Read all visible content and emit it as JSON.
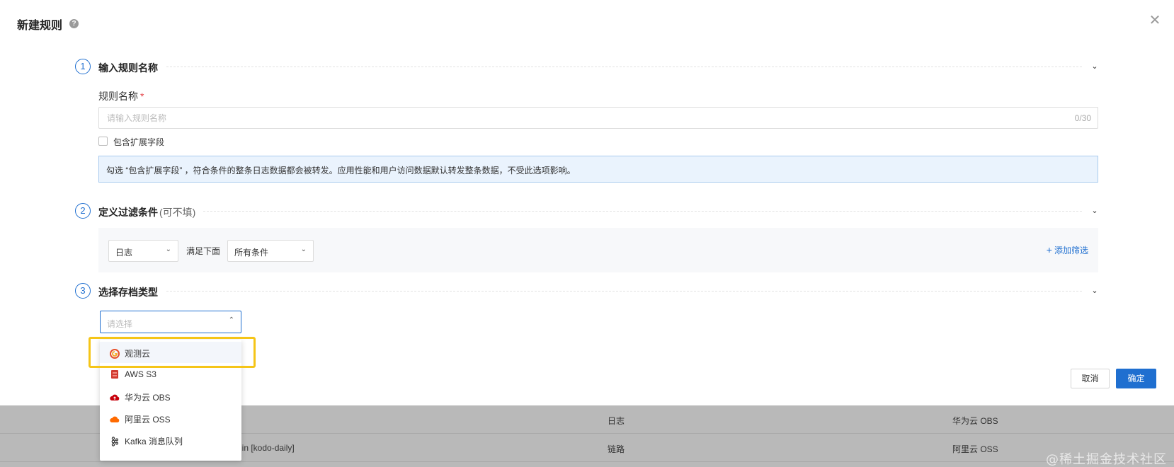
{
  "modal": {
    "title": "新建规则",
    "help_icon": "question-circle-icon",
    "close_icon": "close-icon"
  },
  "step1": {
    "num": "1",
    "title": "输入规则名称",
    "name_label": "规则名称",
    "required_mark": "*",
    "input_placeholder": "请输入规则名称",
    "input_value": "",
    "counter": "0/30",
    "checkbox_label": "包含扩展字段",
    "checkbox_checked": false,
    "info_text": "勾选 “包含扩展字段” ，符合条件的整条日志数据都会被转发。应用性能和用户访问数据默认转发整条数据，不受此选项影响。"
  },
  "step2": {
    "num": "2",
    "title": "定义过滤条件",
    "title_hint": "(可不填)",
    "source_select": "日志",
    "match_text": "满足下面",
    "condition_select": "所有条件",
    "add_filter": "添加筛选"
  },
  "step3": {
    "num": "3",
    "title": "选择存档类型",
    "select_placeholder": "请选择",
    "options": [
      {
        "label": "观测云",
        "icon": "guance-cloud-icon",
        "color": "#e8512a"
      },
      {
        "label": "AWS S3",
        "icon": "aws-s3-icon",
        "color": "#d13a2f"
      },
      {
        "label": "华为云 OBS",
        "icon": "huawei-obs-icon",
        "color": "#c7000b"
      },
      {
        "label": "阿里云 OSS",
        "icon": "aliyun-oss-icon",
        "color": "#ff6a00"
      },
      {
        "label": "Kafka 消息队列",
        "icon": "kafka-icon",
        "color": "#333333"
      }
    ]
  },
  "footer": {
    "cancel": "取消",
    "confirm": "确定"
  },
  "background_table": {
    "rows": [
      {
        "name": "",
        "type": "日志",
        "archive": "华为云 OBS"
      },
      {
        "name": "ice in [kodo-daily]",
        "type": "链路",
        "archive": "阿里云 OSS"
      }
    ]
  },
  "watermark": "@稀土掘金技术社区",
  "colors": {
    "primary": "#1f6fd0",
    "highlight": "#f5c518",
    "info_bg": "#eaf3fd"
  }
}
